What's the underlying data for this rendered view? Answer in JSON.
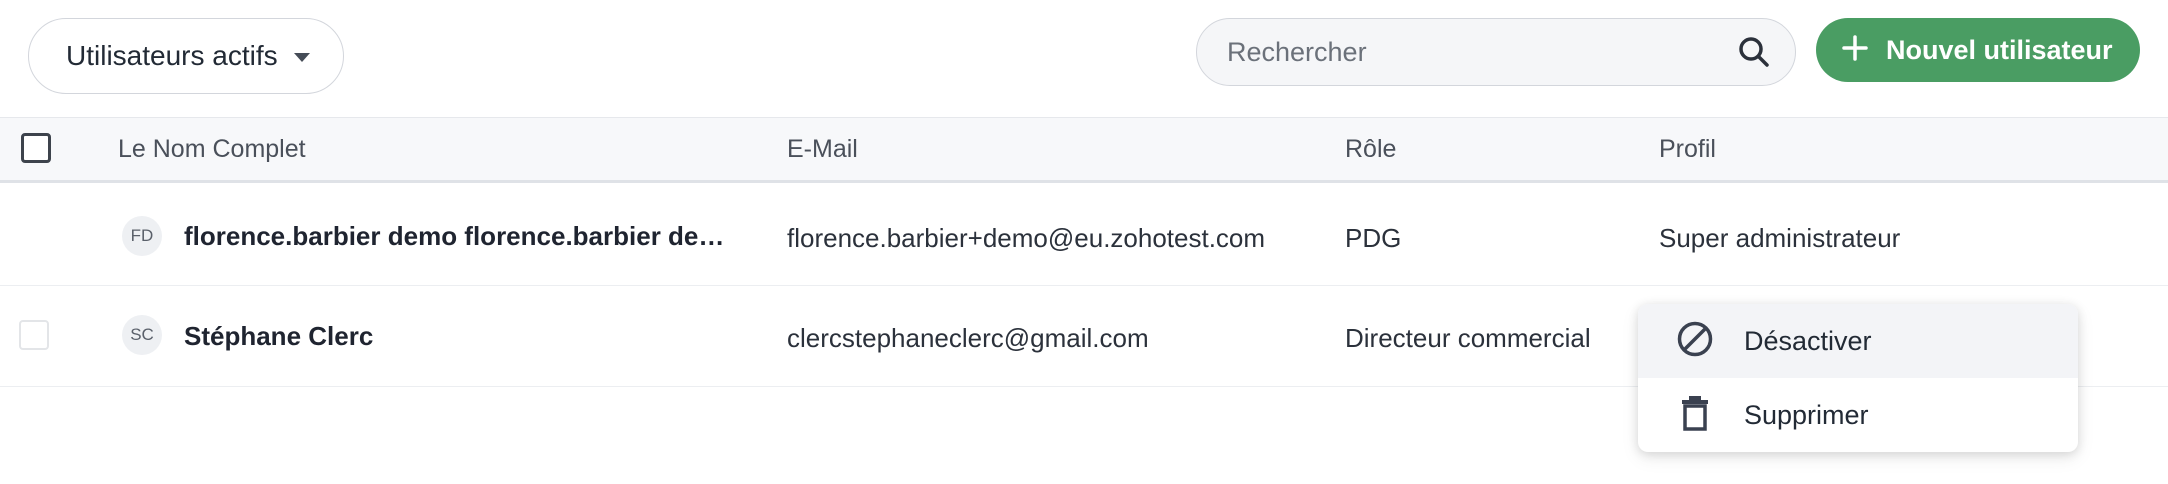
{
  "toolbar": {
    "filter_label": "Utilisateurs actifs",
    "search_placeholder": "Rechercher",
    "new_user_label": "Nouvel utilisateur"
  },
  "table": {
    "headers": [
      "Le Nom Complet",
      "E-Mail",
      "Rôle",
      "Profil"
    ],
    "rows": [
      {
        "initials": "FD",
        "name": "florence.barbier demo florence.barbier de…",
        "email": "florence.barbier+demo@eu.zohotest.com",
        "role": "PDG",
        "profile": "Super administrateur"
      },
      {
        "initials": "SC",
        "name": "Stéphane Clerc",
        "email": "clercstephaneclerc@gmail.com",
        "role": "Directeur commercial",
        "profile": ""
      }
    ]
  },
  "context_menu": {
    "items": [
      {
        "label": "Désactiver",
        "icon": "block-icon"
      },
      {
        "label": "Supprimer",
        "icon": "trash-icon"
      }
    ]
  },
  "colors": {
    "primary_green": "#4a9d63",
    "header_bg": "#f7f8fa"
  }
}
